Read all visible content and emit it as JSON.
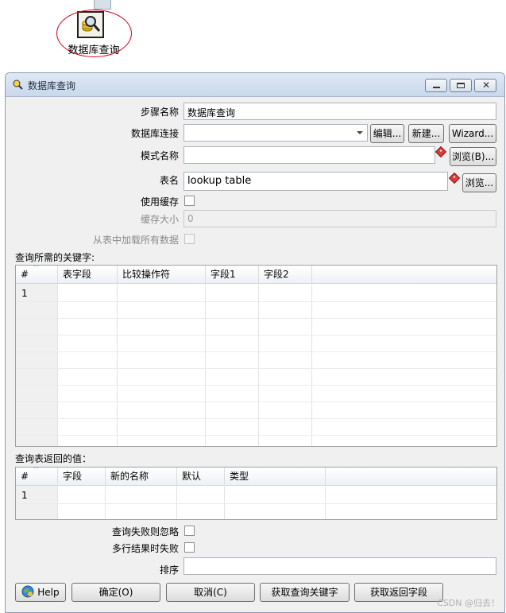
{
  "canvas": {
    "step_label": "数据库查询"
  },
  "window": {
    "title": "数据库查询"
  },
  "form": {
    "step_name": {
      "label": "步骤名称",
      "value": "数据库查询"
    },
    "db_connection": {
      "label": "数据库连接",
      "value": "",
      "edit_label": "编辑...",
      "new_label": "新建...",
      "wizard_label": "Wizard..."
    },
    "schema": {
      "label": "模式名称",
      "value": "",
      "browse_label": "浏览(B)..."
    },
    "table": {
      "label": "表名",
      "value": "lookup table",
      "browse_label": "浏览..."
    },
    "use_cache": {
      "label": "使用缓存"
    },
    "cache_size": {
      "label": "缓存大小",
      "value": "0"
    },
    "load_all": {
      "label": "从表中加载所有数据"
    }
  },
  "keys_grid": {
    "label": "查询所需的关键字:",
    "columns": [
      "#",
      "表字段",
      "比较操作符",
      "字段1",
      "字段2"
    ],
    "rows": [
      [
        "1",
        "",
        "",
        "",
        ""
      ]
    ]
  },
  "return_grid": {
    "label": "查询表返回的值：",
    "columns": [
      "#",
      "字段",
      "新的名称",
      "默认",
      "类型"
    ],
    "rows": [
      [
        "1",
        "",
        "",
        "",
        ""
      ]
    ]
  },
  "options": {
    "ignore_fail": {
      "label": "查询失败则忽略"
    },
    "fail_multi": {
      "label": "多行结果时失败"
    },
    "order_by": {
      "label": "排序",
      "value": ""
    }
  },
  "buttons": {
    "help": "Help",
    "ok": "确定(O)",
    "cancel": "取消(C)",
    "get_keys": "获取查询关键字",
    "get_fields": "获取返回字段"
  },
  "watermark": "CSDN @归去！",
  "colors": {
    "required_marker": "#e03a3a",
    "annotation_ellipse": "#d8001a"
  }
}
